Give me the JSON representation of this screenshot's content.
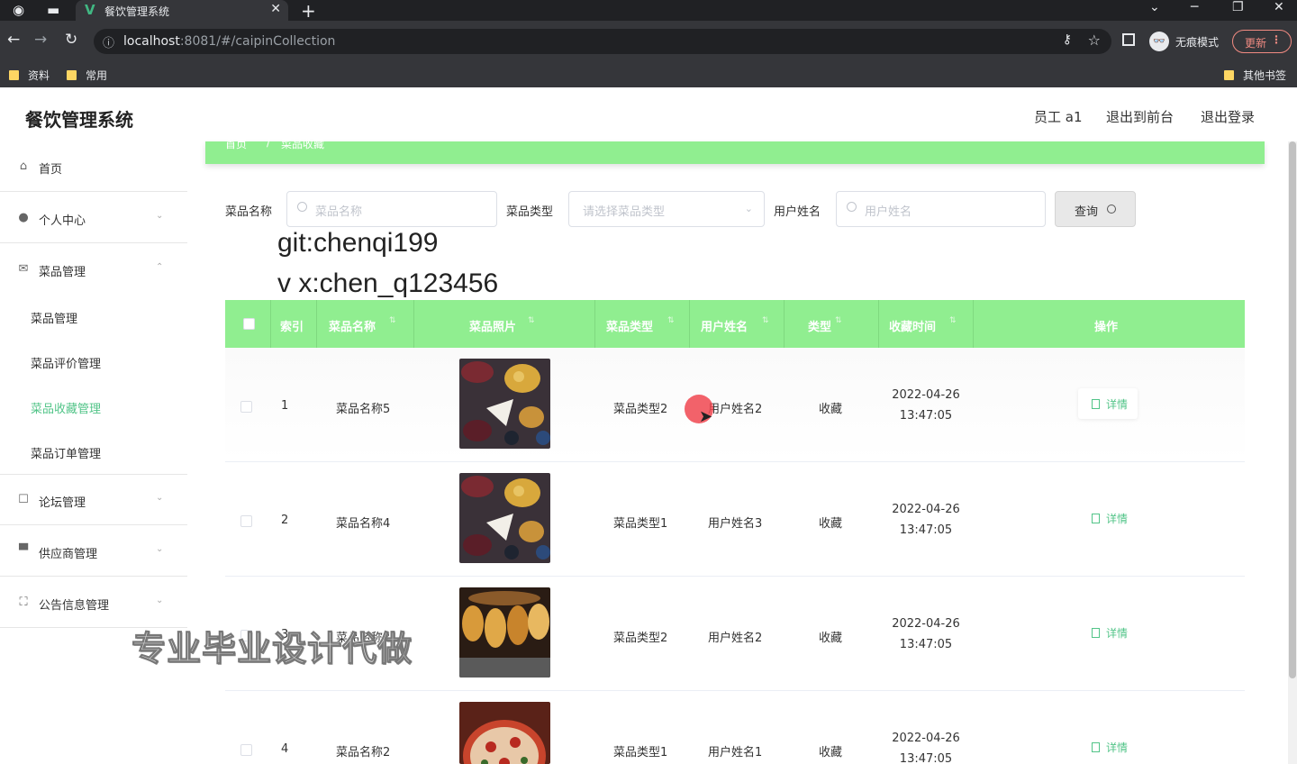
{
  "browser": {
    "tab_title": "餐饮管理系统",
    "tab_icon": "vue-logo-icon",
    "url_host": "localhost",
    "url_rest": ":8081/#/caipinCollection",
    "incognito_label": "无痕模式",
    "update_label": "更新",
    "bookmarks": [
      "资料",
      "常用"
    ],
    "bookmarks_right": "其他书签"
  },
  "header": {
    "brand": "餐饮管理系统",
    "user": "员工 a1",
    "to_front": "退出到前台",
    "logout": "退出登录"
  },
  "sidebar": {
    "items": [
      {
        "label": "首页",
        "icon": "home-icon"
      },
      {
        "label": "个人中心",
        "icon": "user-icon"
      },
      {
        "label": "菜品管理",
        "icon": "mail-icon"
      },
      {
        "label": "论坛管理",
        "icon": "chat-icon"
      },
      {
        "label": "供应商管理",
        "icon": "podium-icon"
      },
      {
        "label": "公告信息管理",
        "icon": "frame-icon"
      }
    ],
    "submenu": [
      "菜品管理",
      "菜品评价管理",
      "菜品收藏管理",
      "菜品订单管理"
    ],
    "active_sub": "菜品收藏管理"
  },
  "breadcrumb": [
    "首页",
    "菜品收藏"
  ],
  "search": {
    "name_label": "菜品名称",
    "name_placeholder": "菜品名称",
    "type_label": "菜品类型",
    "type_placeholder": "请选择菜品类型",
    "user_label": "用户姓名",
    "user_placeholder": "用户姓名",
    "query_button": "查询"
  },
  "overlay": {
    "git": "git:chenqi199",
    "vx": "v x:chen_q123456",
    "banner": "专业毕业设计代做"
  },
  "table": {
    "columns": [
      "索引",
      "菜品名称",
      "菜品照片",
      "菜品类型",
      "用户姓名",
      "类型",
      "收藏时间",
      "操作"
    ],
    "detail_label": "详情",
    "rows": [
      {
        "index": "1",
        "name": "菜品名称5",
        "type": "菜品类型2",
        "user": "用户姓名2",
        "kind": "收藏",
        "date": "2022-04-26",
        "time": "13:47:05",
        "photo": "platter"
      },
      {
        "index": "2",
        "name": "菜品名称4",
        "type": "菜品类型1",
        "user": "用户姓名3",
        "kind": "收藏",
        "date": "2022-04-26",
        "time": "13:47:05",
        "photo": "platter"
      },
      {
        "index": "3",
        "name": "菜品名称3",
        "type": "菜品类型2",
        "user": "用户姓名2",
        "kind": "收藏",
        "date": "2022-04-26",
        "time": "13:47:05",
        "photo": "skewers"
      },
      {
        "index": "4",
        "name": "菜品名称2",
        "type": "菜品类型1",
        "user": "用户姓名1",
        "kind": "收藏",
        "date": "2022-04-26",
        "time": "13:47:05",
        "photo": "pizza"
      }
    ]
  },
  "colors": {
    "accent_green": "#90ee90",
    "link_green": "#52c488"
  }
}
